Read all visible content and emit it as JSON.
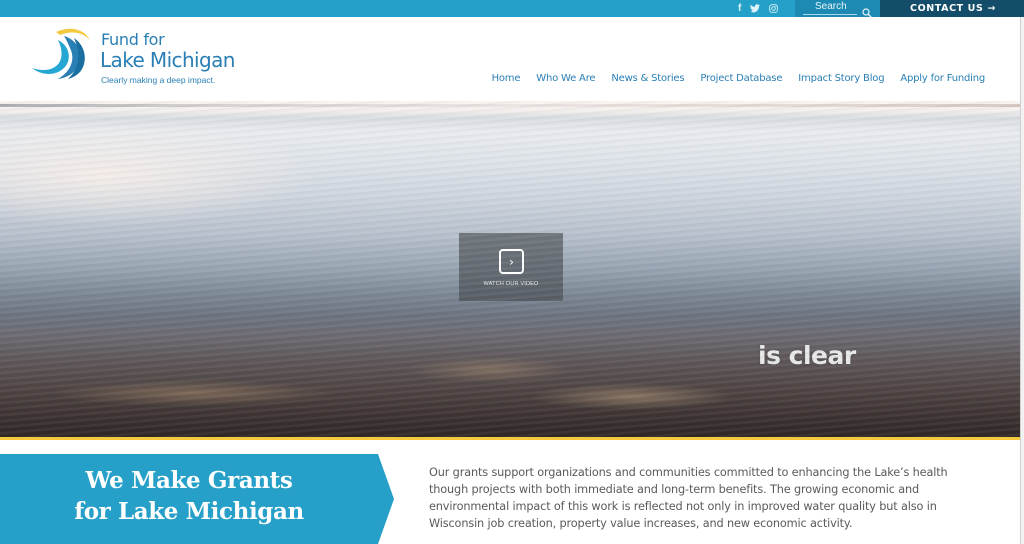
{
  "topbar": {
    "social": [
      {
        "icon": "facebook-icon",
        "glyph": "f"
      },
      {
        "icon": "twitter-icon",
        "glyph": ""
      },
      {
        "icon": "instagram-icon",
        "glyph": ""
      }
    ],
    "search_label": "Search",
    "contact_label": "CONTACT US →"
  },
  "header": {
    "logo_line1": "Fund for",
    "logo_line2": "Lake Michigan",
    "logo_tagline": "Clearly making a deep impact.",
    "nav": [
      {
        "label": "Home"
      },
      {
        "label": "Who We Are"
      },
      {
        "label": "News & Stories"
      },
      {
        "label": "Project Database"
      },
      {
        "label": "Impact Story Blog"
      },
      {
        "label": "Apply for Funding"
      }
    ]
  },
  "hero": {
    "video_label": "WATCH OUR VIDEO",
    "caption": "is clear"
  },
  "intro": {
    "banner_line1": "We Make Grants",
    "banner_line2": "for Lake Michigan",
    "paragraph": "Our grants support organizations and communities committed to enhancing the Lake’s health though projects with both immediate and long-term benefits. The growing economic and environmental impact of this work is reflected not only in improved water quality but also in Wisconsin job creation, property value increases, and new economic activity."
  },
  "colors": {
    "topbar": "#24a0c9",
    "search_bg": "#1d8ab3",
    "contact_bg": "#134d6a",
    "brand_blue": "#2a7fb5",
    "banner_blue": "#26a0c8",
    "gold": "#f5c93e"
  }
}
